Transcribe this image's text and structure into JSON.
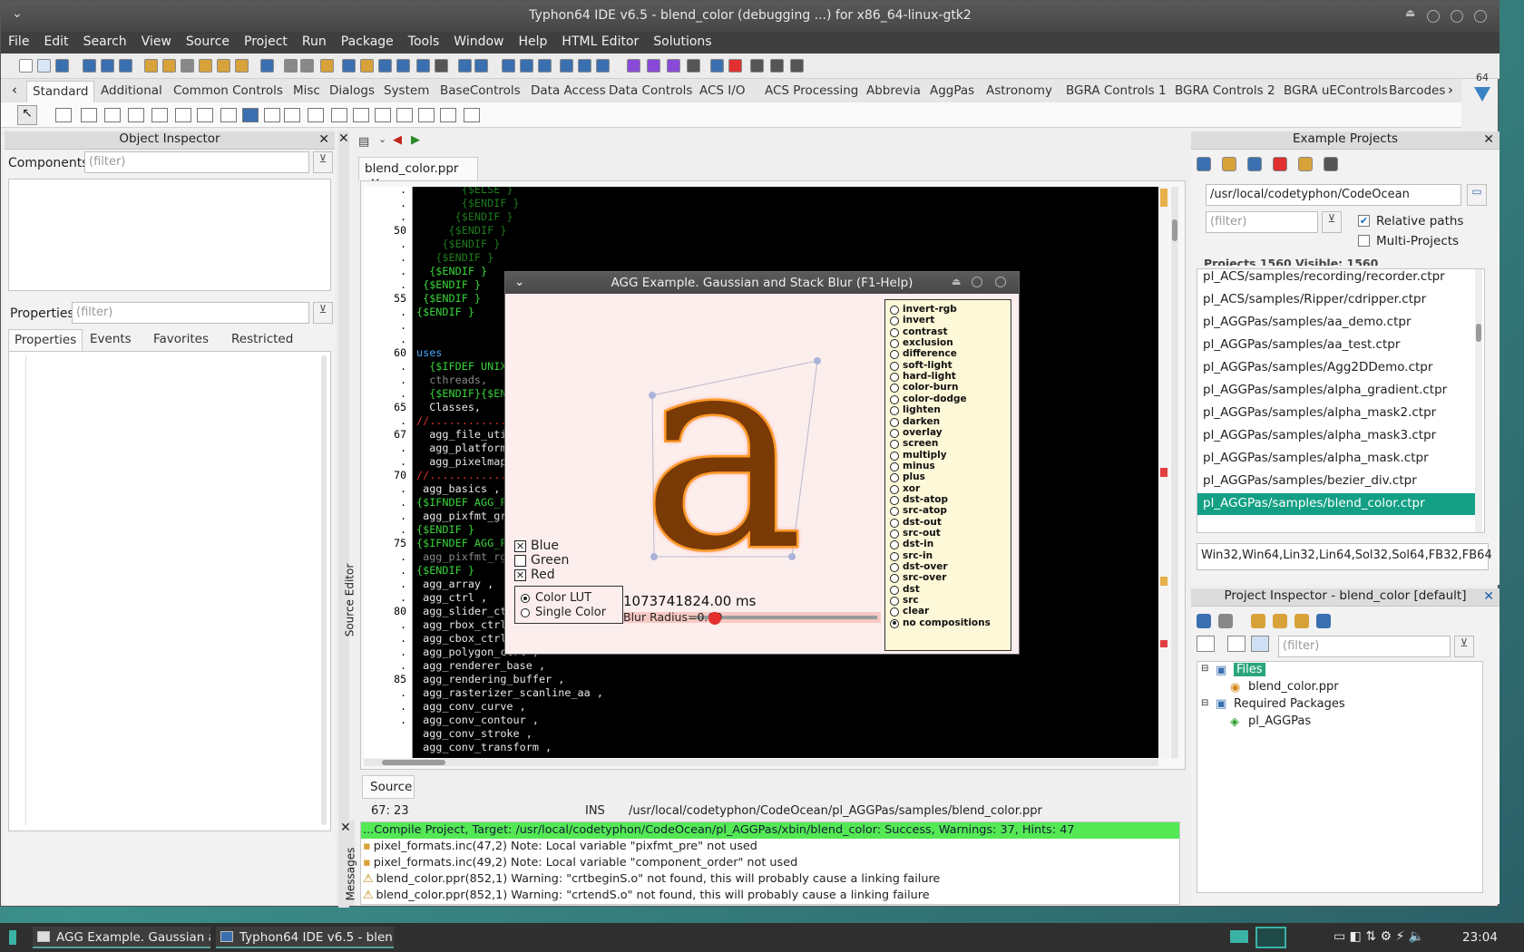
{
  "window": {
    "title": "Typhon64 IDE v6.5 - blend_color (debugging ...) for x86_64-linux-gtk2"
  },
  "menu": [
    "File",
    "Edit",
    "Search",
    "View",
    "Source",
    "Project",
    "Run",
    "Package",
    "Tools",
    "Window",
    "Help",
    "HTML Editor",
    "Solutions"
  ],
  "palette_tabs": [
    "Standard",
    "Additional",
    "Common Controls",
    "Misc",
    "Dialogs",
    "System",
    "BaseControls",
    "Data Access",
    "Data Controls",
    "ACS I/O",
    "ACS Processing",
    "Abbrevia",
    "AggPas",
    "Astronomy",
    "BGRA Controls 1",
    "BGRA Controls 2",
    "BGRA uEControls",
    "Barcodes"
  ],
  "palette_badge": "64",
  "object_inspector": {
    "title": "Object Inspector",
    "components_label": "Components",
    "properties_label": "Properties",
    "filter_placeholder": "(filter)",
    "tabs": [
      "Properties",
      "Events",
      "Favorites",
      "Restricted"
    ]
  },
  "source_editor": {
    "file_tab": "blend_color.ppr",
    "side_label": "Source Editor",
    "bottom_tab": "Source",
    "status": {
      "pos": "67: 23",
      "mode": "INS",
      "path": "/usr/local/codetyphon/CodeOcean/pl_AGGPas/samples/blend_color.ppr"
    }
  },
  "gutter": [
    ".",
    ".",
    ".",
    "50",
    ".",
    ".",
    ".",
    ".",
    "55",
    ".",
    ".",
    ".",
    "60",
    ".",
    ".",
    ".",
    "65",
    ".",
    "67",
    ".",
    ".",
    "70",
    ".",
    ".",
    ".",
    ".",
    "75",
    ".",
    ".",
    ".",
    ".",
    "80",
    ".",
    ".",
    ".",
    ".",
    "85",
    ".",
    ".",
    "."
  ],
  "code_lines": [
    {
      "t": "       {$ELSE }",
      "c": "#1d7a1d"
    },
    {
      "t": "       {$ENDIF }",
      "c": "#1d7a1d"
    },
    {
      "t": "      {$ENDIF }",
      "c": "#1d7a1d"
    },
    {
      "t": "     {$ENDIF }",
      "c": "#1d7a1d"
    },
    {
      "t": "    {$ENDIF }",
      "c": "#1d7a1d"
    },
    {
      "t": "   {$ENDIF }",
      "c": "#1d7a1d"
    },
    {
      "t": "  {$ENDIF }",
      "c": "#39d339"
    },
    {
      "t": " {$ENDIF }",
      "c": "#39d339"
    },
    {
      "t": " {$ENDIF }",
      "c": "#39d339"
    },
    {
      "t": "{$ENDIF }",
      "c": "#39d339"
    },
    {
      "t": "",
      "c": "#fff"
    },
    {
      "t": "",
      "c": "#fff"
    },
    {
      "t": "uses",
      "c": "#4aa8ff"
    },
    {
      "t": "  {$IFDEF UNIX",
      "c": "#39d339"
    },
    {
      "t": "  cthreads,",
      "c": "#888"
    },
    {
      "t": "  {$ENDIF}{$EN",
      "c": "#39d339"
    },
    {
      "t": "  Classes,",
      "c": "#e8e8e8"
    },
    {
      "t": "//............",
      "c": "#e03030"
    },
    {
      "t": "  agg_file_uti",
      "c": "#e8e8e8"
    },
    {
      "t": "  agg_platform",
      "c": "#e8e8e8"
    },
    {
      "t": "  agg_pixelmap",
      "c": "#e8e8e8"
    },
    {
      "t": "//............",
      "c": "#e03030"
    },
    {
      "t": " agg_basics ,",
      "c": "#e8e8e8"
    },
    {
      "t": "{$IFNDEF AGG_P",
      "c": "#39d339"
    },
    {
      "t": " agg_pixfmt_gr",
      "c": "#e8e8e8"
    },
    {
      "t": "{$ENDIF }",
      "c": "#39d339"
    },
    {
      "t": "{$IFNDEF AGG_P",
      "c": "#39d339"
    },
    {
      "t": " agg_pixfmt_rg",
      "c": "#888"
    },
    {
      "t": "{$ENDIF }",
      "c": "#39d339"
    },
    {
      "t": " agg_array ,",
      "c": "#e8e8e8"
    },
    {
      "t": " agg_ctrl ,",
      "c": "#e8e8e8"
    },
    {
      "t": " agg_slider_ct",
      "c": "#e8e8e8"
    },
    {
      "t": " agg_rbox_ctrl",
      "c": "#e8e8e8"
    },
    {
      "t": " agg_cbox_ctrl",
      "c": "#e8e8e8"
    },
    {
      "t": " agg_polygon_ctrl ,",
      "c": "#e8e8e8"
    },
    {
      "t": " agg_renderer_base ,",
      "c": "#e8e8e8"
    },
    {
      "t": " agg_rendering_buffer ,",
      "c": "#e8e8e8"
    },
    {
      "t": " agg_rasterizer_scanline_aa ,",
      "c": "#e8e8e8"
    },
    {
      "t": " agg_conv_curve ,",
      "c": "#e8e8e8"
    },
    {
      "t": " agg_conv_contour ,",
      "c": "#e8e8e8"
    },
    {
      "t": " agg_conv_stroke ,",
      "c": "#e8e8e8"
    },
    {
      "t": " agg_conv_transform ,",
      "c": "#e8e8e8"
    }
  ],
  "agg": {
    "title": "AGG Example. Gaussian and Stack Blur (F1-Help)",
    "glyph": "a",
    "channels": [
      {
        "label": "Blue",
        "checked": true
      },
      {
        "label": "Green",
        "checked": false
      },
      {
        "label": "Red",
        "checked": true
      }
    ],
    "modes": [
      {
        "label": "Color LUT",
        "on": true
      },
      {
        "label": "Single Color",
        "on": false
      }
    ],
    "time": "1073741824.00  ms",
    "slider_label": "Blur Radius=0.00",
    "slider_value": 0,
    "compositions": [
      "invert-rgb",
      "invert",
      "contrast",
      "exclusion",
      "difference",
      "soft-light",
      "hard-light",
      "color-burn",
      "color-dodge",
      "lighten",
      "darken",
      "overlay",
      "screen",
      "multiply",
      "minus",
      "plus",
      "xor",
      "dst-atop",
      "src-atop",
      "dst-out",
      "src-out",
      "dst-in",
      "src-in",
      "dst-over",
      "src-over",
      "dst",
      "src",
      "clear",
      "no compositions"
    ],
    "selected_composition": "no compositions"
  },
  "examples": {
    "title": "Example Projects",
    "path": "/usr/local/codetyphon/CodeOcean",
    "filter_placeholder": "(filter)",
    "relative_paths": "Relative paths",
    "multi_projects": "Multi-Projects",
    "counts": "Projects 1560  Visible: 1560",
    "platforms": "Win32,Win64,Lin32,Lin64,Sol32,Sol64,FB32,FB64",
    "items": [
      "pl_ACS/samples/recording/recorder.ctpr",
      "pl_ACS/samples/Ripper/cdripper.ctpr",
      "pl_AGGPas/samples/aa_demo.ctpr",
      "pl_AGGPas/samples/aa_test.ctpr",
      "pl_AGGPas/samples/Agg2DDemo.ctpr",
      "pl_AGGPas/samples/alpha_gradient.ctpr",
      "pl_AGGPas/samples/alpha_mask2.ctpr",
      "pl_AGGPas/samples/alpha_mask3.ctpr",
      "pl_AGGPas/samples/alpha_mask.ctpr",
      "pl_AGGPas/samples/bezier_div.ctpr",
      "pl_AGGPas/samples/blend_color.ctpr"
    ],
    "selected": "pl_AGGPas/samples/blend_color.ctpr"
  },
  "project_inspector": {
    "title": "Project Inspector - blend_color [default]",
    "filter_placeholder": "(filter)",
    "tree": {
      "files": "Files",
      "file1": "blend_color.ppr",
      "req": "Required Packages",
      "pkg1": "pl_AGGPas"
    }
  },
  "messages": {
    "label": "Messages",
    "success": "...Compile Project, Target: /usr/local/codetyphon/CodeOcean/pl_AGGPas/xbin/blend_color: Success, Warnings: 37, Hints: 47",
    "lines": [
      {
        "t": "pixel_formats.inc(47,2) Note: Local variable \"pixfmt_pre\" not used",
        "k": "note"
      },
      {
        "t": "pixel_formats.inc(49,2) Note: Local variable \"component_order\" not used",
        "k": "note"
      },
      {
        "t": "blend_color.ppr(852,1) Warning: \"crtbeginS.o\" not found, this will probably cause a linking failure",
        "k": "warn"
      },
      {
        "t": "blend_color.ppr(852,1) Warning: \"crtendS.o\" not found, this will probably cause a linking failure",
        "k": "warn"
      }
    ]
  },
  "taskbar": {
    "tasks": [
      "AGG Example. Gaussian a...",
      "Typhon64 IDE v6.5 - blen..."
    ],
    "clock": "23:04"
  }
}
